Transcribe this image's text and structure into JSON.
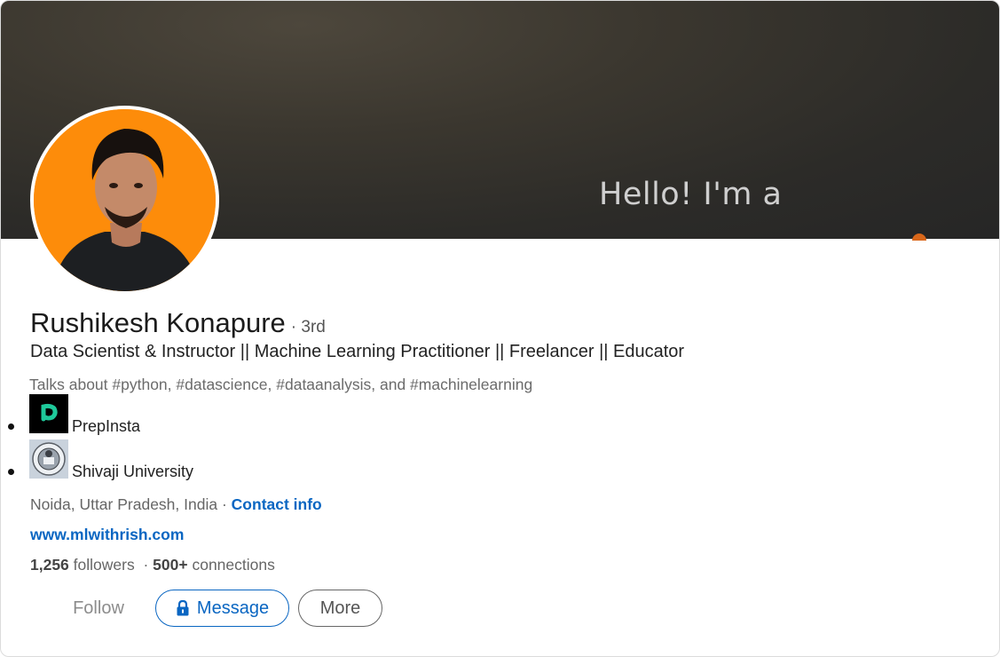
{
  "banner": {
    "text": "Hello! I'm a"
  },
  "profile": {
    "name": "Rushikesh Konapure",
    "degree": "· 3rd",
    "headline": "Data Scientist & Instructor || Machine Learning Practitioner || Freelancer || Educator",
    "talks_about": "Talks about #python, #datascience, #dataanalysis, and #machinelearning",
    "organizations": [
      {
        "name": "PrepInsta",
        "icon": "prepinsta-logo-icon"
      },
      {
        "name": "Shivaji University",
        "icon": "shivaji-university-seal-icon"
      }
    ],
    "location": "Noida, Uttar Pradesh, India",
    "separator": "·",
    "contact_info": "Contact info",
    "website": "www.mlwithrish.com",
    "followers": "1,256",
    "followers_label": "followers",
    "connections": "500+",
    "connections_label": "connections"
  },
  "actions": {
    "follow": "Follow",
    "message": "Message",
    "more": "More"
  },
  "colors": {
    "accent": "#0a66c2",
    "avatar_background": "#fd8c0a",
    "banner": "#2c2b28"
  }
}
